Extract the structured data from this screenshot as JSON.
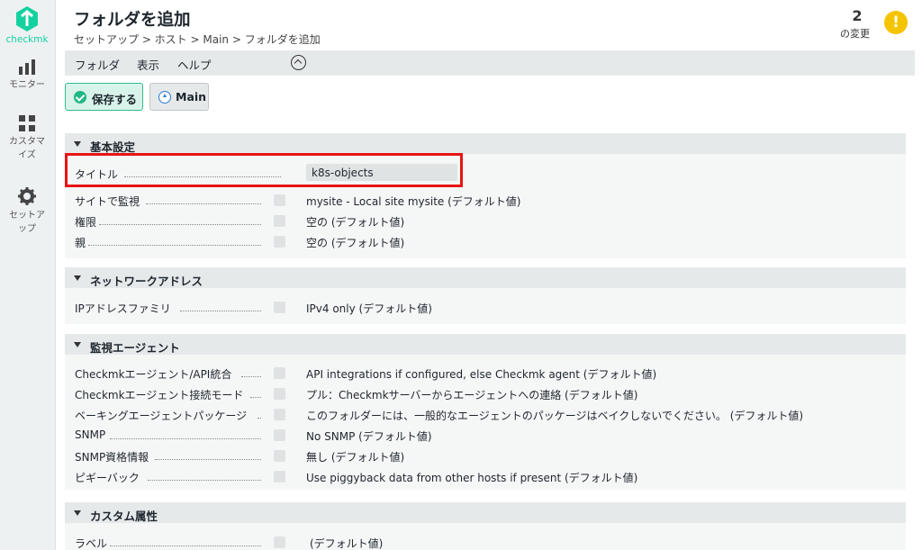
{
  "app": {
    "brand": "checkmk",
    "brand_color": "#15d1a0"
  },
  "sidebar": {
    "items": [
      {
        "label": "モニター",
        "icon": "bar-chart-icon"
      },
      {
        "label": "カスタマイズ",
        "icon": "grid-icon"
      },
      {
        "label": "セットアップ",
        "icon": "gear-icon"
      }
    ]
  },
  "header": {
    "title": "フォルダを追加",
    "breadcrumb": "セットアップ > ホスト > Main > フォルダを追加",
    "changes_count": "2",
    "changes_label": "の変更",
    "warning_icon": "!"
  },
  "menubar": {
    "items": [
      "フォルダ",
      "表示",
      "ヘルプ"
    ]
  },
  "toolbar": {
    "save_label": "保存する",
    "main_label": "Main"
  },
  "sections": {
    "basic": {
      "title": "基本設定",
      "title_label": "タイトル",
      "title_value": "k8s-objects",
      "site_label": "サイトで監視",
      "site_value": "mysite - Local site mysite (デフォルト値)",
      "perm_label": "権限",
      "perm_value": "空の (デフォルト値)",
      "parent_label": "親",
      "parent_value": "空の (デフォルト値)"
    },
    "network": {
      "title": "ネットワークアドレス",
      "ip_label": "IPアドレスファミリ",
      "ip_value": "IPv4 only (デフォルト値)"
    },
    "agent": {
      "title": "監視エージェント",
      "rows": [
        {
          "label": "Checkmkエージェント/API統合",
          "value": "API integrations if configured, else Checkmk agent (デフォルト値)"
        },
        {
          "label": "Checkmkエージェント接続モード",
          "value": "プル：Checkmkサーバーからエージェントへの連絡 (デフォルト値)"
        },
        {
          "label": "ベーキングエージェントパッケージ",
          "value": "このフォルダーには、一般的なエージェントのパッケージはベイクしないでください。 (デフォルト値)"
        },
        {
          "label": "SNMP",
          "value": "No SNMP (デフォルト値)"
        },
        {
          "label": "SNMP資格情報",
          "value": "無し (デフォルト値)"
        },
        {
          "label": "ピギーバック",
          "value": "Use piggyback data from other hosts if present (デフォルト値)"
        }
      ]
    },
    "custom": {
      "title": "カスタム属性",
      "label_label": "ラベル",
      "label_value": "(デフォルト値)"
    }
  }
}
